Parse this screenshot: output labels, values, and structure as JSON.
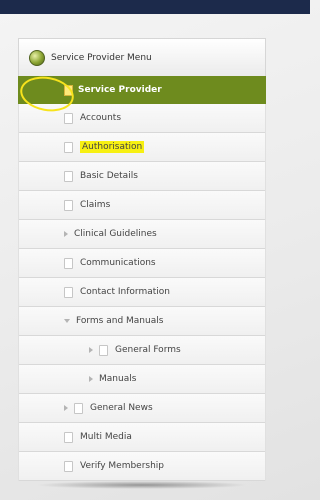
{
  "menu": {
    "title": "Service Provider Menu",
    "selected": "Service Provider",
    "accent_color": "#6e8b1e",
    "items": [
      {
        "label": "Accounts",
        "icon": "page-icon"
      },
      {
        "label": "Authorisation",
        "icon": "page-icon",
        "highlighted": true
      },
      {
        "label": "Basic Details",
        "icon": "page-icon"
      },
      {
        "label": "Claims",
        "icon": "page-icon"
      },
      {
        "label": "Clinical Guidelines",
        "icon": "chevron-right-icon"
      },
      {
        "label": "Communications",
        "icon": "page-icon"
      },
      {
        "label": "Contact Information",
        "icon": "page-icon"
      },
      {
        "label": "Forms and Manuals",
        "icon": "chevron-down-icon"
      },
      {
        "label": "General Forms",
        "icon": "page-icon"
      },
      {
        "label": "Manuals",
        "icon": "chevron-right-icon"
      },
      {
        "label": "General News",
        "icon": "page-icon"
      },
      {
        "label": "Multi Media",
        "icon": "page-icon"
      },
      {
        "label": "Verify Membership",
        "icon": "page-icon"
      }
    ]
  }
}
